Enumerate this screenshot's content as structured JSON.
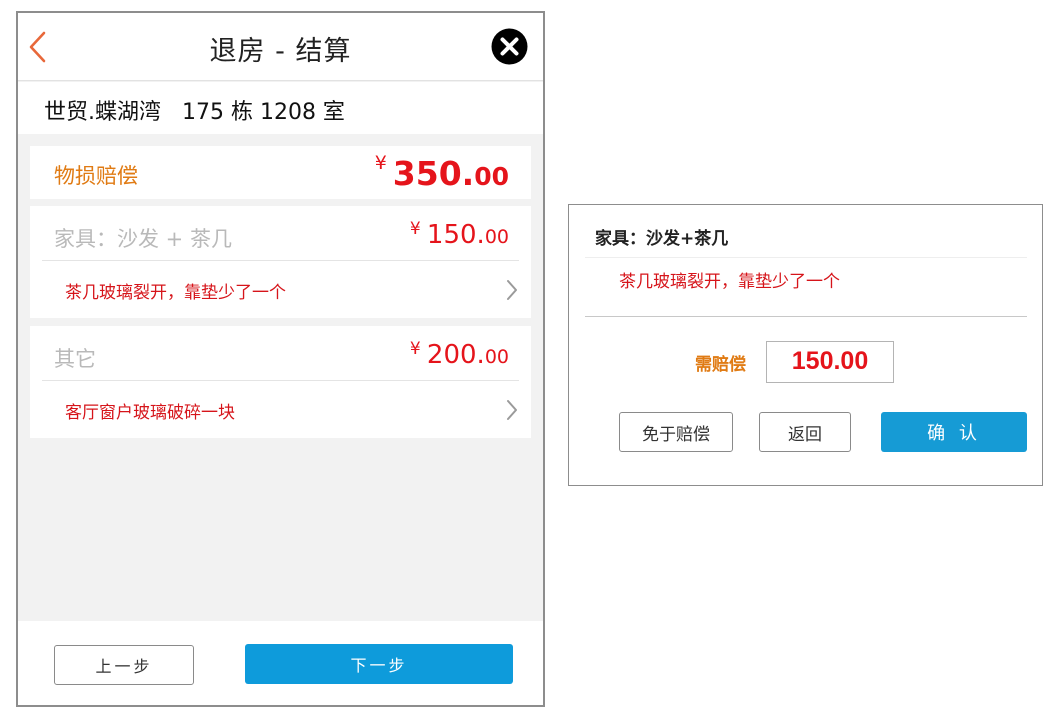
{
  "colors": {
    "accent_orange": "#e07b14",
    "price_red": "#e5141b",
    "primary_blue": "#0e9bdb"
  },
  "header": {
    "back_icon": "chevron-left-icon",
    "title": "退房 - 结算",
    "close_icon": "close-circle-icon"
  },
  "address": {
    "text": "世贸.蝶湖湾   175 栋 1208 室"
  },
  "total": {
    "label": "物损赔偿",
    "currency": "¥",
    "amount_int": "350.",
    "amount_dec": "00"
  },
  "items": [
    {
      "title": "家具：沙发 + 茶几",
      "currency": "¥",
      "amount_int": "150.",
      "amount_dec": "00",
      "description": "茶几玻璃裂开，靠垫少了一个",
      "chevron_icon": "chevron-right-icon"
    },
    {
      "title": "其它",
      "currency": "¥",
      "amount_int": "200.",
      "amount_dec": "00",
      "description": "客厅窗户玻璃破碎一块",
      "chevron_icon": "chevron-right-icon"
    }
  ],
  "footer": {
    "prev_label": "上一步",
    "next_label": "下一步"
  },
  "dialog": {
    "title": "家具：沙发+茶几",
    "description": "茶几玻璃裂开，靠垫少了一个",
    "amount_label": "需赔偿",
    "amount_value": "150.00",
    "waive_label": "免于赔偿",
    "back_label": "返回",
    "confirm_label": "确 认"
  }
}
